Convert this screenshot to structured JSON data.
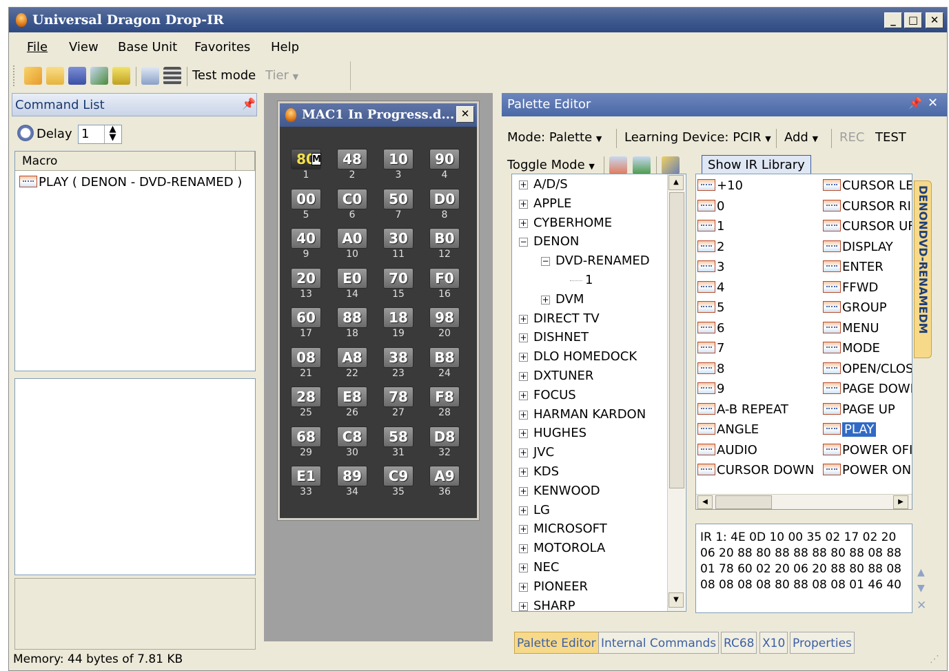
{
  "window": {
    "title": "Universal Dragon Drop-IR",
    "minimize": "_",
    "maximize": "□",
    "close": "✕"
  },
  "menu": [
    "File",
    "View",
    "Base Unit",
    "Favorites",
    "Help"
  ],
  "toolbar": {
    "test_mode": "Test mode",
    "tier": "Tier"
  },
  "command_list": {
    "title": "Command List",
    "delay_label": "Delay",
    "delay_value": "1",
    "column": "Macro",
    "items": [
      "PLAY ( DENON - DVD-RENAMED )"
    ]
  },
  "macro_window": {
    "title": "MAC1 In Progress.d...",
    "keys": [
      {
        "code": "80",
        "num": "1",
        "active": true
      },
      {
        "code": "48",
        "num": "2"
      },
      {
        "code": "10",
        "num": "3"
      },
      {
        "code": "90",
        "num": "4"
      },
      {
        "code": "00",
        "num": "5"
      },
      {
        "code": "C0",
        "num": "6"
      },
      {
        "code": "50",
        "num": "7"
      },
      {
        "code": "D0",
        "num": "8"
      },
      {
        "code": "40",
        "num": "9"
      },
      {
        "code": "A0",
        "num": "10"
      },
      {
        "code": "30",
        "num": "11"
      },
      {
        "code": "B0",
        "num": "12"
      },
      {
        "code": "20",
        "num": "13"
      },
      {
        "code": "E0",
        "num": "14"
      },
      {
        "code": "70",
        "num": "15"
      },
      {
        "code": "F0",
        "num": "16"
      },
      {
        "code": "60",
        "num": "17"
      },
      {
        "code": "88",
        "num": "18"
      },
      {
        "code": "18",
        "num": "19"
      },
      {
        "code": "98",
        "num": "20"
      },
      {
        "code": "08",
        "num": "21"
      },
      {
        "code": "A8",
        "num": "22"
      },
      {
        "code": "38",
        "num": "23"
      },
      {
        "code": "B8",
        "num": "24"
      },
      {
        "code": "28",
        "num": "25"
      },
      {
        "code": "E8",
        "num": "26"
      },
      {
        "code": "78",
        "num": "27"
      },
      {
        "code": "F8",
        "num": "28"
      },
      {
        "code": "68",
        "num": "29"
      },
      {
        "code": "C8",
        "num": "30"
      },
      {
        "code": "58",
        "num": "31"
      },
      {
        "code": "D8",
        "num": "32"
      },
      {
        "code": "E1",
        "num": "33"
      },
      {
        "code": "89",
        "num": "34"
      },
      {
        "code": "C9",
        "num": "35"
      },
      {
        "code": "A9",
        "num": "36"
      }
    ],
    "m_marker": "M"
  },
  "palette_editor": {
    "title": "Palette Editor",
    "mode": "Mode: Palette",
    "learning_device": "Learning Device: PCIR",
    "add": "Add",
    "rec": "REC",
    "test": "TEST",
    "toggle_mode": "Toggle Mode",
    "show_ir_library": "Show IR Library",
    "side_tab": "DENONDVD-RENAMEDM",
    "tree": [
      {
        "label": "A/D/S",
        "level": 0,
        "sign": "+"
      },
      {
        "label": "APPLE",
        "level": 0,
        "sign": "+"
      },
      {
        "label": "CYBERHOME",
        "level": 0,
        "sign": "+"
      },
      {
        "label": "DENON",
        "level": 0,
        "sign": "−"
      },
      {
        "label": "DVD-RENAMED",
        "level": 1,
        "sign": "−"
      },
      {
        "label": "1",
        "level": 2,
        "sign": ""
      },
      {
        "label": "DVM",
        "level": 1,
        "sign": "+"
      },
      {
        "label": "DIRECT TV",
        "level": 0,
        "sign": "+"
      },
      {
        "label": "DISHNET",
        "level": 0,
        "sign": "+"
      },
      {
        "label": "DLO HOMEDOCK",
        "level": 0,
        "sign": "+"
      },
      {
        "label": "DXTUNER",
        "level": 0,
        "sign": "+"
      },
      {
        "label": "FOCUS",
        "level": 0,
        "sign": "+"
      },
      {
        "label": "HARMAN KARDON",
        "level": 0,
        "sign": "+"
      },
      {
        "label": "HUGHES",
        "level": 0,
        "sign": "+"
      },
      {
        "label": "JVC",
        "level": 0,
        "sign": "+"
      },
      {
        "label": "KDS",
        "level": 0,
        "sign": "+"
      },
      {
        "label": "KENWOOD",
        "level": 0,
        "sign": "+"
      },
      {
        "label": "LG",
        "level": 0,
        "sign": "+"
      },
      {
        "label": "MICROSOFT",
        "level": 0,
        "sign": "+"
      },
      {
        "label": "MOTOROLA",
        "level": 0,
        "sign": "+"
      },
      {
        "label": "NEC",
        "level": 0,
        "sign": "+"
      },
      {
        "label": "PIONEER",
        "level": 0,
        "sign": "+"
      },
      {
        "label": "SHARP",
        "level": 0,
        "sign": "+"
      }
    ],
    "commands_left": [
      "+10",
      "0",
      "1",
      "2",
      "3",
      "4",
      "5",
      "6",
      "7",
      "8",
      "9",
      "A-B REPEAT",
      "ANGLE",
      "AUDIO",
      "CURSOR DOWN"
    ],
    "commands_right": [
      "CURSOR LE",
      "CURSOR RI",
      "CURSOR UF",
      "DISPLAY",
      "ENTER",
      "FFWD",
      "GROUP",
      "MENU",
      "MODE",
      "OPEN/CLOS",
      "PAGE DOWI",
      "PAGE UP",
      "PLAY",
      "POWER OFI",
      "POWER ON"
    ],
    "selected_command": "PLAY",
    "hex": [
      "IR 1: 4E 0D 10 00 35 02 17 02 20",
      "06 20 88 80 88 88 88 80 88 08 88",
      "01 78 60 02 20 06 20 88 80 88 08",
      "08 08 08 08 80 88 08 08 01 46 40"
    ],
    "tabs": [
      "Palette Editor",
      "Internal Commands",
      "RC68",
      "X10",
      "Properties"
    ]
  },
  "status": {
    "memory": "Memory: 44 bytes of 7.81 KB"
  }
}
